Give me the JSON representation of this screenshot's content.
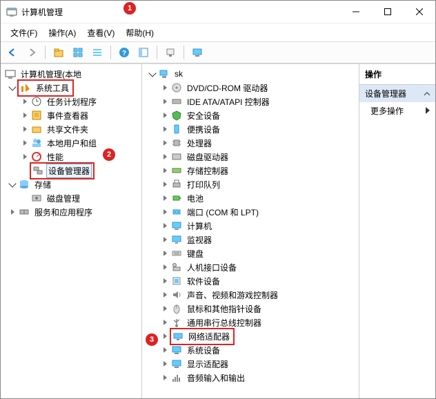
{
  "window": {
    "title": "计算机管理"
  },
  "menu": {
    "file": "文件(F)",
    "action": "操作(A)",
    "view": "查看(V)",
    "help": "帮助(H)"
  },
  "markers": {
    "m1": "1",
    "m2": "2",
    "m3": "3"
  },
  "left_tree": {
    "root": "计算机管理(本地",
    "system_tools": "系统工具",
    "task_scheduler": "任务计划程序",
    "event_viewer": "事件查看器",
    "shared_folders": "共享文件夹",
    "local_users": "本地用户和组",
    "performance": "性能",
    "device_manager": "设备管理器",
    "storage": "存储",
    "disk_mgmt": "磁盘管理",
    "services_apps": "服务和应用程序"
  },
  "center_tree": {
    "root": "sk",
    "dvd": "DVD/CD-ROM 驱动器",
    "ide": "IDE ATA/ATAPI 控制器",
    "security": "安全设备",
    "portable": "便携设备",
    "cpu": "处理器",
    "disk_drive": "磁盘驱动器",
    "storage_ctrl": "存储控制器",
    "print_queue": "打印队列",
    "battery": "电池",
    "ports": "端口 (COM 和 LPT)",
    "computer": "计算机",
    "monitor": "监视器",
    "keyboard": "键盘",
    "hid": "人机接口设备",
    "software_dev": "软件设备",
    "sound": "声音、视频和游戏控制器",
    "mouse": "鼠标和其他指针设备",
    "usb": "通用串行总线控制器",
    "network": "网络适配器",
    "system_dev": "系统设备",
    "display": "显示适配器",
    "audio_io": "音频输入和输出"
  },
  "actions": {
    "header": "操作",
    "subheader": "设备管理器",
    "more": "更多操作"
  }
}
